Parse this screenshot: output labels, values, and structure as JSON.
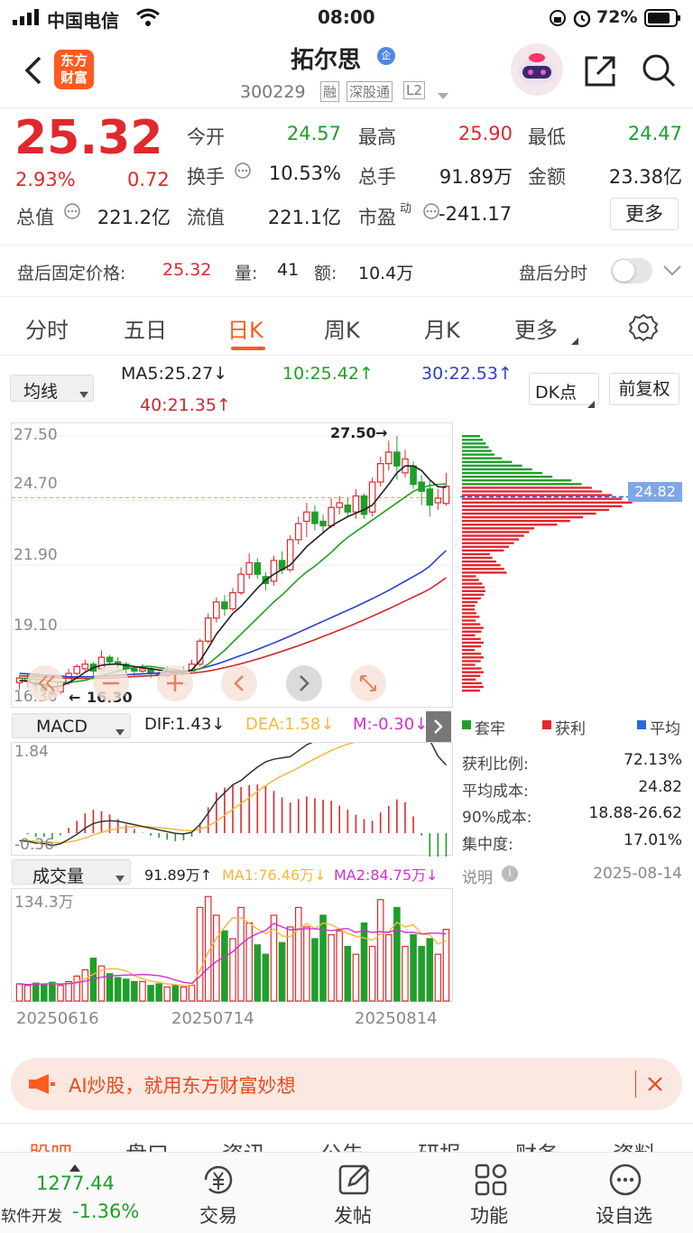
{
  "status": {
    "carrier": "中国电信",
    "time": "08:00",
    "battery": "72%"
  },
  "header": {
    "brand_line1": "东方",
    "brand_line2": "财富",
    "title": "拓尔思",
    "title_badge": "企",
    "code": "300229",
    "tags": [
      "融",
      "深股通",
      "L2"
    ]
  },
  "quote": {
    "price": "25.32",
    "change_pct": "2.93%",
    "change": "0.72",
    "fields": [
      {
        "label": "今开",
        "value": "24.57",
        "color": "green"
      },
      {
        "label": "最高",
        "value": "25.90",
        "color": "red"
      },
      {
        "label": "最低",
        "value": "24.47",
        "color": "green"
      },
      {
        "label": "换手",
        "value": "10.53%",
        "color": "dark"
      },
      {
        "label": "总手",
        "value": "91.89万",
        "color": "dark"
      },
      {
        "label": "金额",
        "value": "23.38亿",
        "color": "dark"
      },
      {
        "label": "总值",
        "value": "221.2亿",
        "color": "dark"
      },
      {
        "label": "流值",
        "value": "221.1亿",
        "color": "dark"
      },
      {
        "label": "市盈",
        "value": "-241.17",
        "color": "dark",
        "sup": "动"
      }
    ],
    "more_label": "更多"
  },
  "afterhours": {
    "label": "盘后固定价格:",
    "price": "25.32",
    "vol_label": "量:",
    "vol": "41",
    "amt_label": "额:",
    "amt": "10.4万",
    "toggle_label": "盘后分时"
  },
  "tabs": [
    "分时",
    "五日",
    "日K",
    "周K",
    "月K",
    "更多"
  ],
  "active_tab": "日K",
  "ma": {
    "select": "均线",
    "ma5": "MA5:25.27↓",
    "ma10": "10:25.42↑",
    "ma30": "30:22.53↑",
    "ma40": "40:21.35↑",
    "dk": "DK点",
    "fq": "前复权"
  },
  "kline": {
    "price_labels": [
      "27.50",
      "24.70",
      "21.90",
      "19.10",
      "16.30"
    ],
    "high_mark": "27.50",
    "low_mark": "16.30",
    "dashed_price": "24.82",
    "candles": [
      [
        16.8,
        17.0,
        16.5,
        17.1
      ],
      [
        16.9,
        17.0,
        16.6,
        17.2
      ],
      [
        16.8,
        16.7,
        16.4,
        17.0
      ],
      [
        16.6,
        16.5,
        16.2,
        16.8
      ],
      [
        16.4,
        16.3,
        16.2,
        16.6
      ],
      [
        16.4,
        16.8,
        16.3,
        16.9
      ],
      [
        16.8,
        17.2,
        16.7,
        17.4
      ],
      [
        17.2,
        17.5,
        17.1,
        17.6
      ],
      [
        17.4,
        17.6,
        17.3,
        17.8
      ],
      [
        17.6,
        17.3,
        17.1,
        17.7
      ],
      [
        17.4,
        17.9,
        17.3,
        18.2
      ],
      [
        17.9,
        17.7,
        17.5,
        18.0
      ],
      [
        17.7,
        17.6,
        17.4,
        17.9
      ],
      [
        17.6,
        17.4,
        17.2,
        17.7
      ],
      [
        17.4,
        17.3,
        17.1,
        17.5
      ],
      [
        17.3,
        17.4,
        17.2,
        17.6
      ],
      [
        17.4,
        17.2,
        17.0,
        17.5
      ],
      [
        17.2,
        17.1,
        16.9,
        17.3
      ],
      [
        17.1,
        17.3,
        17.0,
        17.5
      ],
      [
        17.3,
        17.2,
        17.1,
        17.4
      ],
      [
        17.2,
        17.3,
        17.1,
        17.5
      ],
      [
        17.3,
        17.6,
        17.3,
        17.8
      ],
      [
        17.6,
        18.6,
        17.5,
        18.7
      ],
      [
        18.6,
        19.6,
        18.5,
        19.8
      ],
      [
        19.6,
        20.3,
        19.4,
        20.5
      ],
      [
        20.3,
        20.0,
        19.7,
        20.6
      ],
      [
        20.0,
        20.7,
        19.9,
        20.9
      ],
      [
        20.7,
        21.5,
        20.6,
        21.8
      ],
      [
        21.5,
        22.0,
        21.3,
        22.4
      ],
      [
        22.0,
        21.5,
        21.3,
        22.2
      ],
      [
        21.4,
        21.1,
        20.8,
        21.6
      ],
      [
        21.2,
        22.1,
        21.0,
        22.3
      ],
      [
        22.1,
        21.7,
        21.5,
        22.5
      ],
      [
        21.7,
        23.0,
        21.6,
        23.2
      ],
      [
        23.0,
        23.7,
        22.8,
        24.0
      ],
      [
        23.8,
        24.2,
        23.1,
        24.6
      ],
      [
        24.2,
        23.7,
        23.4,
        24.5
      ],
      [
        23.8,
        23.6,
        23.3,
        24.1
      ],
      [
        23.6,
        24.4,
        23.5,
        24.8
      ],
      [
        24.4,
        24.6,
        24.1,
        24.9
      ],
      [
        24.5,
        24.2,
        24.0,
        24.8
      ],
      [
        24.2,
        24.9,
        23.9,
        25.2
      ],
      [
        24.9,
        24.1,
        23.9,
        25.0
      ],
      [
        24.2,
        25.5,
        24.0,
        25.7
      ],
      [
        25.5,
        26.3,
        25.3,
        26.6
      ],
      [
        26.3,
        26.8,
        26.0,
        27.3
      ],
      [
        26.8,
        26.2,
        25.6,
        27.5
      ],
      [
        25.9,
        26.5,
        25.7,
        26.9
      ],
      [
        26.2,
        25.4,
        25.2,
        26.4
      ],
      [
        25.5,
        25.1,
        24.5,
        25.8
      ],
      [
        25.2,
        24.5,
        24.0,
        25.6
      ],
      [
        24.6,
        24.8,
        24.3,
        25.2
      ],
      [
        24.57,
        25.32,
        24.47,
        25.9
      ]
    ],
    "ma5": [
      16.9,
      16.85,
      16.75,
      16.7,
      16.6,
      16.65,
      16.8,
      17.0,
      17.25,
      17.45,
      17.55,
      17.6,
      17.6,
      17.55,
      17.5,
      17.45,
      17.4,
      17.35,
      17.3,
      17.25,
      17.25,
      17.35,
      17.75,
      18.3,
      18.9,
      19.35,
      19.8,
      20.1,
      20.5,
      20.9,
      21.25,
      21.5,
      21.7,
      21.9,
      22.3,
      22.7,
      23.0,
      23.3,
      23.6,
      23.8,
      24.0,
      24.15,
      24.3,
      24.5,
      24.95,
      25.4,
      25.9,
      26.2,
      26.2,
      26.0,
      25.6,
      25.3,
      25.27
    ],
    "ma10": [
      17.0,
      16.98,
      16.95,
      16.9,
      16.85,
      16.8,
      16.8,
      16.85,
      16.9,
      17.0,
      17.1,
      17.2,
      17.3,
      17.4,
      17.45,
      17.5,
      17.5,
      17.45,
      17.4,
      17.35,
      17.3,
      17.3,
      17.4,
      17.6,
      17.9,
      18.2,
      18.55,
      18.9,
      19.25,
      19.6,
      19.95,
      20.3,
      20.6,
      20.95,
      21.3,
      21.6,
      21.85,
      22.15,
      22.45,
      22.8,
      23.1,
      23.35,
      23.6,
      23.85,
      24.1,
      24.35,
      24.6,
      24.85,
      25.1,
      25.25,
      25.35,
      25.4,
      25.42
    ],
    "ma30": [
      17.2,
      17.18,
      17.15,
      17.12,
      17.1,
      17.08,
      17.05,
      17.05,
      17.05,
      17.06,
      17.08,
      17.1,
      17.12,
      17.14,
      17.16,
      17.18,
      17.2,
      17.22,
      17.24,
      17.26,
      17.28,
      17.32,
      17.4,
      17.5,
      17.6,
      17.72,
      17.85,
      17.98,
      18.1,
      18.24,
      18.38,
      18.52,
      18.67,
      18.82,
      18.98,
      19.14,
      19.3,
      19.46,
      19.62,
      19.78,
      19.94,
      20.1,
      20.27,
      20.44,
      20.62,
      20.8,
      21.0,
      21.2,
      21.4,
      21.6,
      21.85,
      22.2,
      22.53
    ],
    "ma40": [
      17.1,
      17.08,
      17.06,
      17.04,
      17.02,
      17.0,
      16.99,
      16.98,
      16.98,
      16.98,
      16.99,
      17.0,
      17.02,
      17.04,
      17.06,
      17.08,
      17.1,
      17.12,
      17.14,
      17.16,
      17.18,
      17.21,
      17.25,
      17.3,
      17.37,
      17.45,
      17.53,
      17.62,
      17.72,
      17.82,
      17.93,
      18.04,
      18.16,
      18.28,
      18.4,
      18.53,
      18.66,
      18.8,
      18.94,
      19.08,
      19.22,
      19.37,
      19.52,
      19.68,
      19.84,
      20.0,
      20.17,
      20.34,
      20.51,
      20.68,
      20.86,
      21.1,
      21.35
    ]
  },
  "chips": {
    "price_label": "24.82",
    "legend": [
      "套牢",
      "获利",
      "平均"
    ],
    "rows": [
      {
        "label": "获利比例:",
        "value": "72.13%"
      },
      {
        "label": "平均成本:",
        "value": "24.82"
      },
      {
        "label": "90%成本:",
        "value": "18.88-26.62"
      },
      {
        "label": "集中度:",
        "value": "17.01%"
      }
    ],
    "note_label": "说明",
    "date": "2025-08-14"
  },
  "macd": {
    "select": "MACD",
    "dif": "DIF:1.43↓",
    "dea": "DEA:1.58↓",
    "m": "M:-0.30↓",
    "top": "1.84",
    "bottom": "-0.36"
  },
  "volume": {
    "select": "成交量",
    "vol": "91.89万↑",
    "ma1": "MA1:76.46万↓",
    "ma2": "MA2:84.75万↓",
    "top": "134.3万",
    "dates": [
      "20250616",
      "20250714",
      "20250814"
    ],
    "values": [
      22,
      20,
      23,
      22,
      24,
      20,
      25,
      32,
      40,
      55,
      45,
      35,
      30,
      28,
      25,
      25,
      20,
      22,
      18,
      20,
      18,
      20,
      120,
      134,
      110,
      90,
      80,
      120,
      100,
      72,
      60,
      110,
      75,
      95,
      120,
      95,
      80,
      110,
      85,
      90,
      70,
      60,
      100,
      70,
      130,
      85,
      120,
      70,
      85,
      70,
      80,
      60,
      91.89
    ]
  },
  "banner": {
    "text": "AI炒股，就用东方财富妙想"
  },
  "subtabs": [
    "股吧",
    "盘口",
    "资讯",
    "公告",
    "研报",
    "财务",
    "资料"
  ],
  "bottom": {
    "index_value": "1277.44",
    "index_name": "软件开发",
    "index_change": "-1.36%",
    "items": [
      "交易",
      "发帖",
      "功能",
      "设自选"
    ]
  },
  "colors": {
    "up": "#e0282e",
    "down": "#1f9e2c",
    "accent": "#ff5a1f",
    "ma5": "#222222",
    "ma10": "#20a020",
    "ma30": "#2a3fd0",
    "ma40": "#d02a2a"
  }
}
